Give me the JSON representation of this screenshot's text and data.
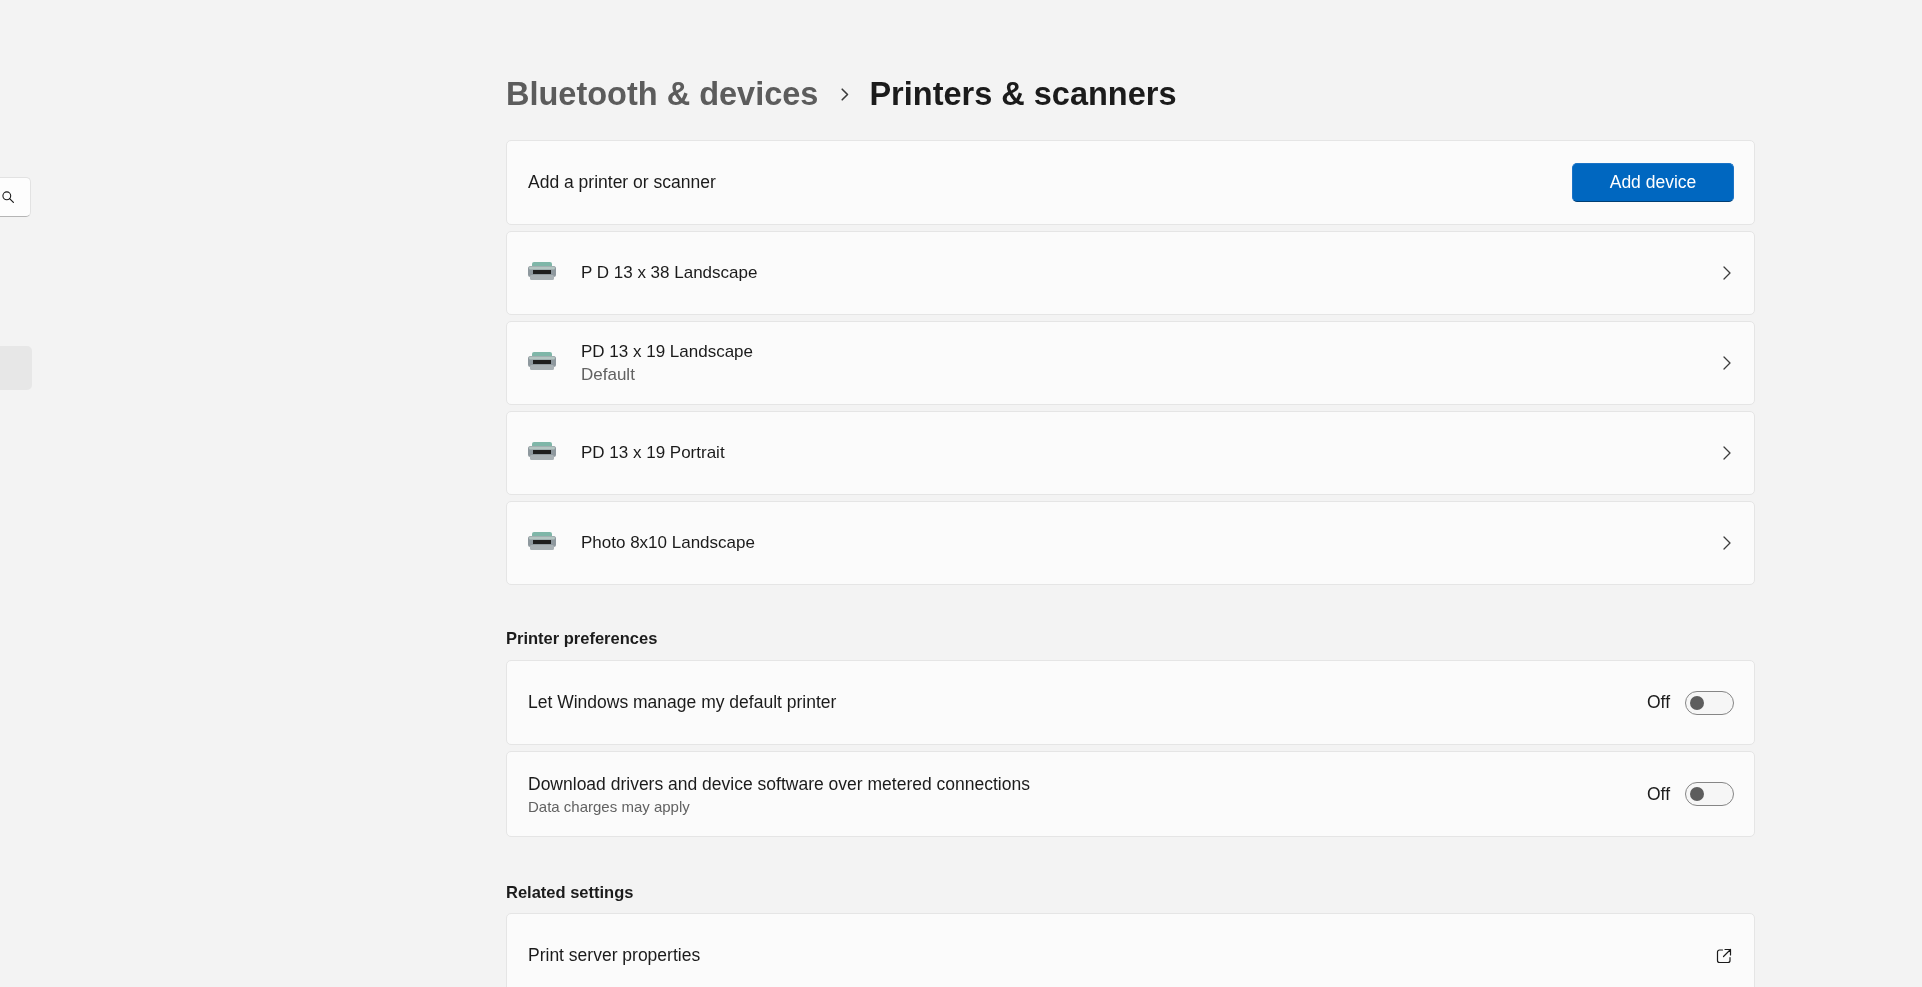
{
  "sidebar": {
    "items": [
      {
        "selected": true
      }
    ]
  },
  "header": {
    "parent": "Bluetooth & devices",
    "title": "Printers & scanners"
  },
  "add_row": {
    "label": "Add a printer or scanner",
    "button": "Add device"
  },
  "printers": [
    {
      "name": "P D 13 x 38 Landscape"
    },
    {
      "name": "PD 13 x 19 Landscape",
      "status": "Default"
    },
    {
      "name": "PD 13 x 19 Portrait"
    },
    {
      "name": "Photo 8x10 Landscape"
    }
  ],
  "printer_preferences": {
    "heading": "Printer preferences",
    "settings": [
      {
        "label": "Let Windows manage my default printer",
        "state_label": "Off",
        "on": false
      },
      {
        "label": "Download drivers and device software over metered connections",
        "description": "Data charges may apply",
        "state_label": "Off",
        "on": false
      }
    ]
  },
  "related_settings": {
    "heading": "Related settings",
    "links": [
      {
        "label": "Print server properties"
      }
    ]
  }
}
